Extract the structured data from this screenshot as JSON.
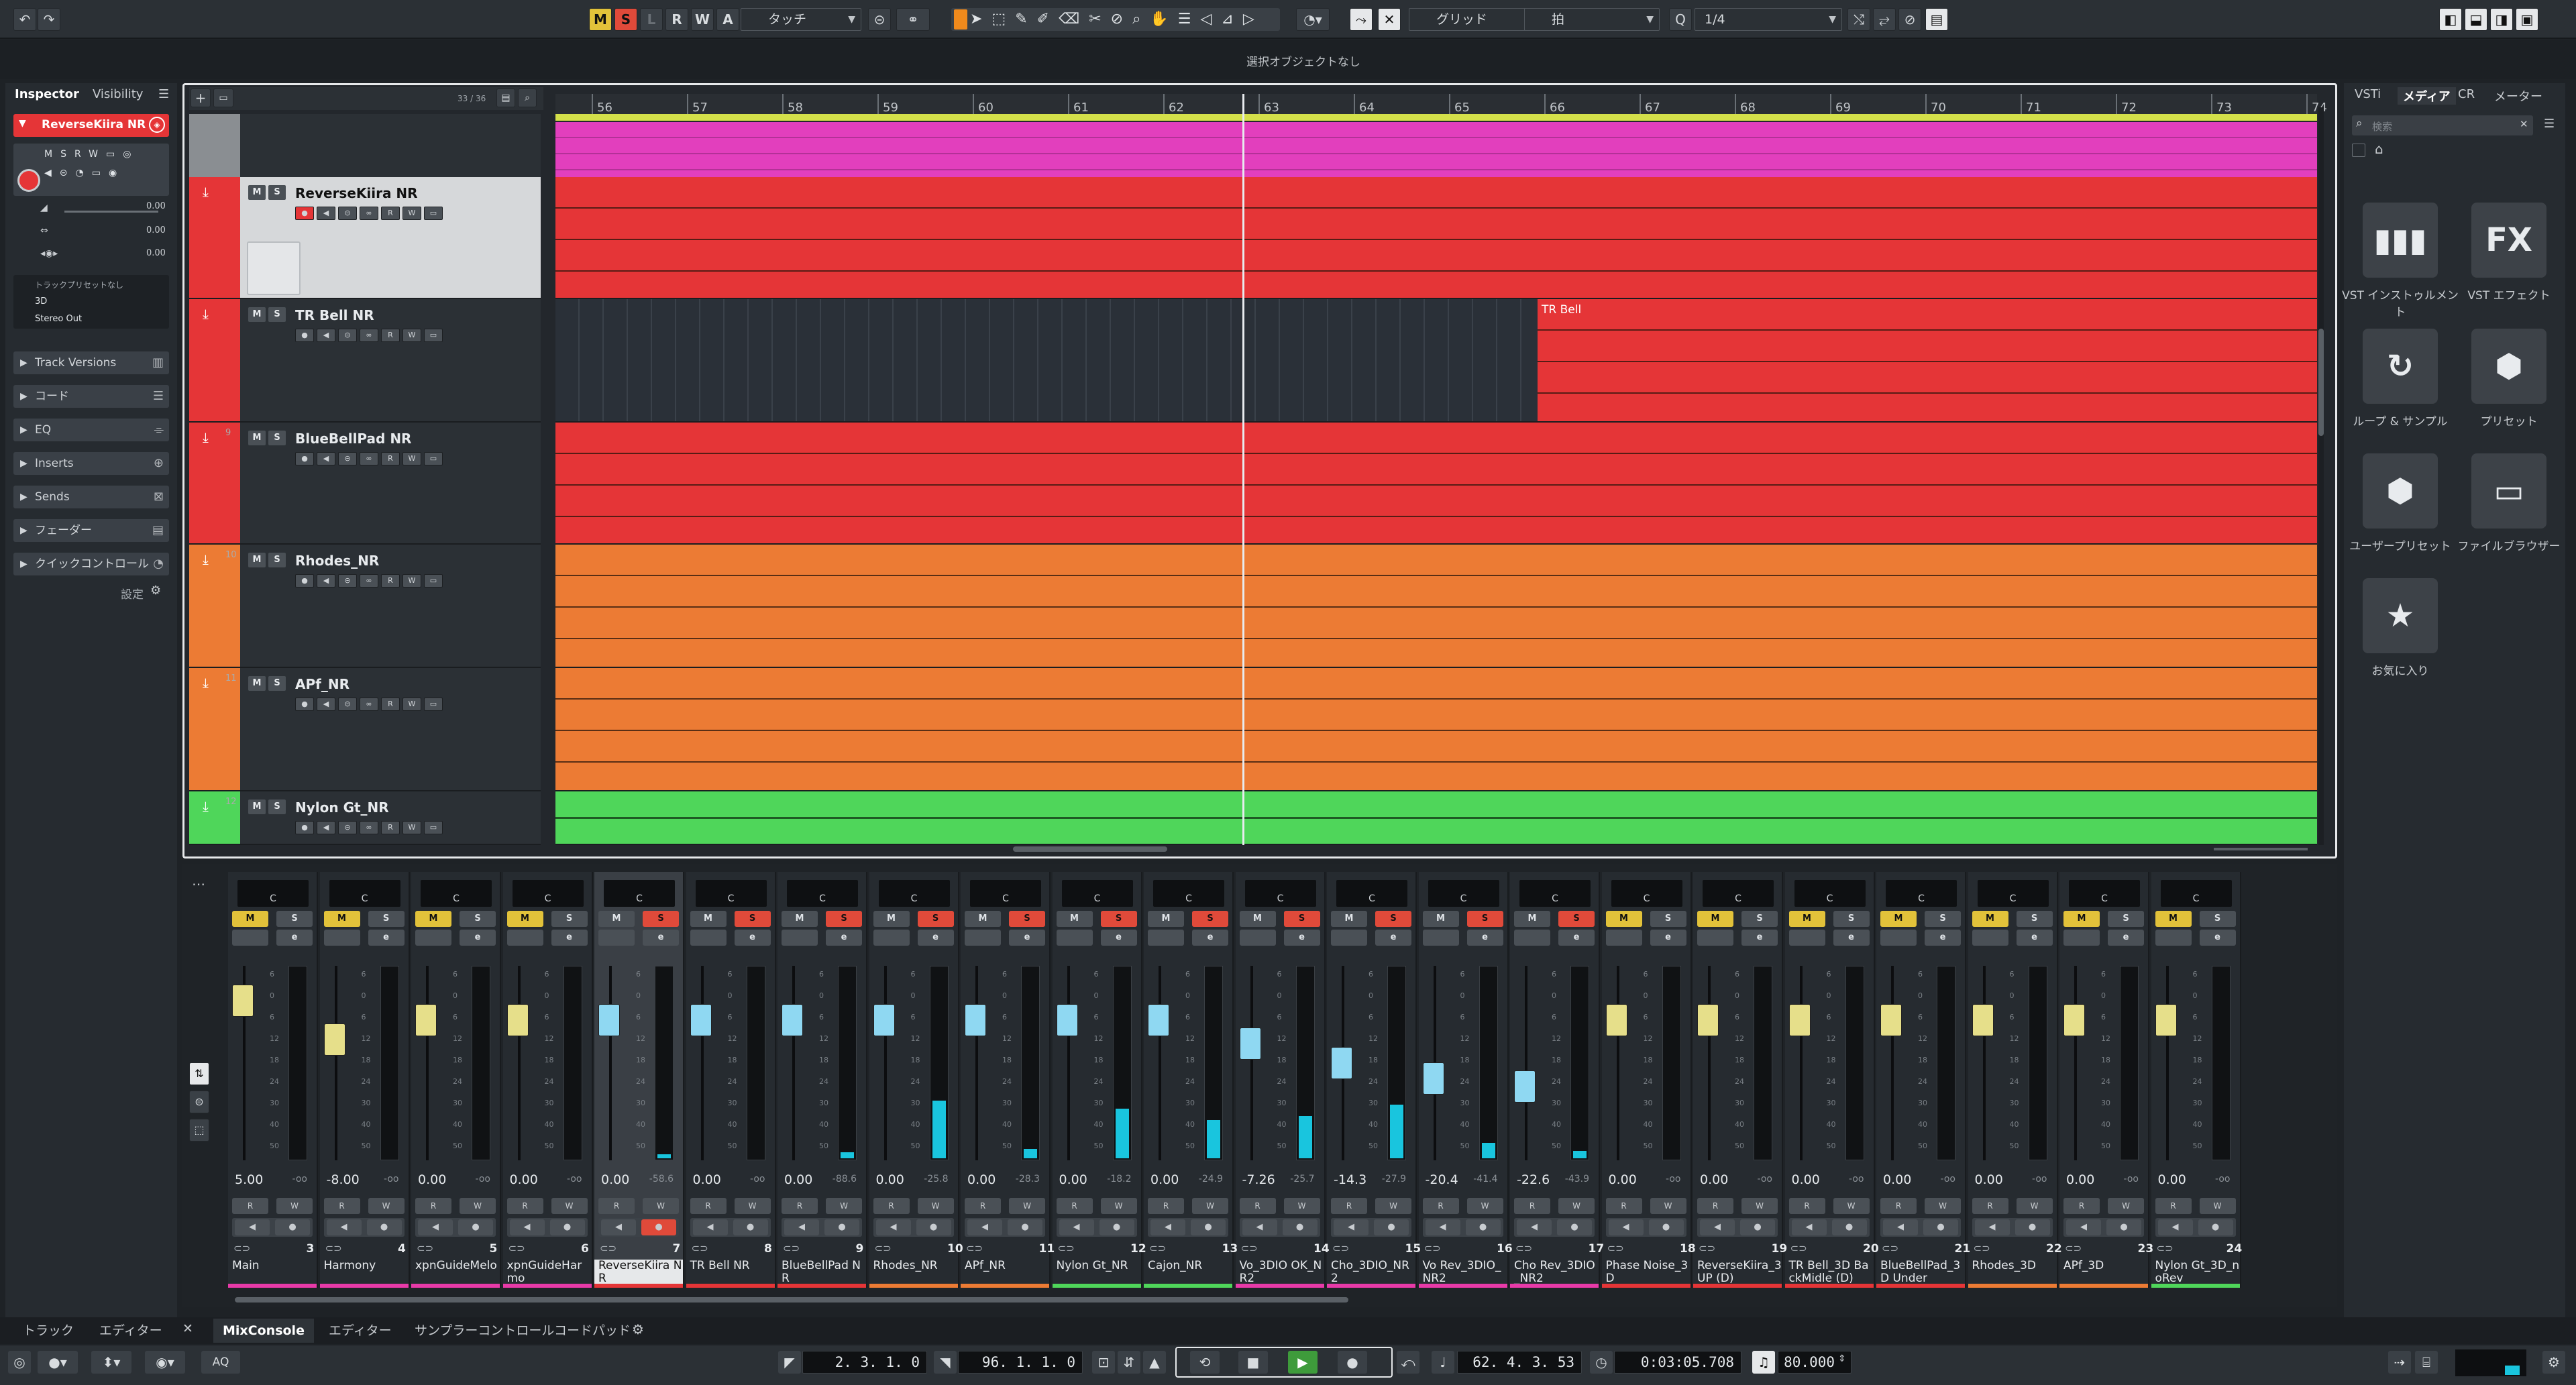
{
  "toolbar": {
    "undo_icon": "undo-icon",
    "redo_icon": "redo-icon",
    "mode_buttons": [
      "M",
      "S",
      "L",
      "R",
      "W",
      "A"
    ],
    "automation_mode": "タッチ",
    "snap_type": "グリッド",
    "grid_type": "拍",
    "quantize": "1/4"
  },
  "status_line": "選択オブジェクトなし",
  "inspector": {
    "tab_inspector": "Inspector",
    "tab_visibility": "Visibility",
    "track_name": "ReverseKiira NR",
    "volume_value": "0.00",
    "pan_value": "0.00",
    "delay_value": "0.00",
    "preset_label": "トラックプリセットなし",
    "routing_in": "3D",
    "routing_out": "Stereo Out",
    "sections": [
      "Track Versions",
      "コード",
      "EQ",
      "Inserts",
      "Sends",
      "フェーダー",
      "クイックコントロール"
    ],
    "settings_label": "設定"
  },
  "project": {
    "track_count": "33 / 36",
    "ruler": [
      "56",
      "57",
      "58",
      "59",
      "60",
      "61",
      "62",
      "63",
      "64",
      "65",
      "66",
      "67",
      "68",
      "69",
      "70",
      "71",
      "72",
      "73",
      "74"
    ],
    "tracks": [
      {
        "name": "ReverseKiira NR",
        "color": "#e53537"
      },
      {
        "name": "TR Bell NR",
        "color": "#e53537"
      },
      {
        "name": "BlueBellPad NR",
        "color": "#e53537"
      },
      {
        "name": "Rhodes_NR",
        "color": "#ec7b34"
      },
      {
        "name": "APf_NR",
        "color": "#ec7b34"
      },
      {
        "name": "Nylon Gt_NR",
        "color": "#4fd65a"
      }
    ],
    "track_numbers": [
      "9",
      "10",
      "11",
      "12"
    ],
    "event_label": "TR Bell"
  },
  "media": {
    "tabs": [
      "VSTi",
      "メディア",
      "CR",
      "メーター"
    ],
    "search_placeholder": "検索",
    "tiles": [
      {
        "label": "VST インストゥルメント",
        "icon": "piano-keys-icon",
        "glyph": "▮▮▮"
      },
      {
        "label": "VST エフェクト",
        "icon": "fx-icon",
        "glyph": "FX"
      },
      {
        "label": "ループ & サンプル",
        "icon": "loop-icon",
        "glyph": "↻"
      },
      {
        "label": "プリセット",
        "icon": "preset-icon",
        "glyph": "⬢"
      },
      {
        "label": "ユーザープリセット",
        "icon": "user-preset-icon",
        "glyph": "⬢"
      },
      {
        "label": "ファイルブラウザー",
        "icon": "file-browser-icon",
        "glyph": "▭"
      },
      {
        "label": "お気に入り",
        "icon": "star-icon",
        "glyph": "★"
      }
    ]
  },
  "mixer": {
    "channels": [
      {
        "name": "Main",
        "num": "",
        "vol": "5.00",
        "peak": "-oo",
        "color": "#e83aa8",
        "mute": "on",
        "solo": "off",
        "fader": 0.82,
        "meter": 0.0
      },
      {
        "name": "Harmony",
        "num": "3",
        "vol": "-8.00",
        "peak": "-oo",
        "color": "#e83aa8",
        "mute": "on",
        "solo": "off",
        "fader": 0.62,
        "meter": 0.0
      },
      {
        "name": "xpnGuideMelo",
        "num": "4",
        "vol": "0.00",
        "peak": "-oo",
        "color": "#e83aa8",
        "mute": "on",
        "solo": "off",
        "fader": 0.72,
        "meter": 0.0
      },
      {
        "name": "xpnGuideHarmo",
        "num": "5",
        "vol": "0.00",
        "peak": "-oo",
        "color": "#e83aa8",
        "mute": "on",
        "solo": "off",
        "fader": 0.72,
        "meter": 0.0
      },
      {
        "name": "ReverseKiira NR",
        "num": "6",
        "vol": "0.00",
        "peak": "-58.6",
        "color": "#e53537",
        "mute": "off",
        "solo": "on",
        "fader": 0.72,
        "meter": 0.02
      },
      {
        "name": "TR Bell NR",
        "num": "7",
        "vol": "0.00",
        "peak": "-oo",
        "color": "#e53537",
        "mute": "off",
        "solo": "on",
        "fader": 0.72,
        "meter": 0.0
      },
      {
        "name": "BlueBellPad NR",
        "num": "8",
        "vol": "0.00",
        "peak": "-88.6",
        "color": "#e53537",
        "mute": "off",
        "solo": "on",
        "fader": 0.72,
        "meter": 0.03
      },
      {
        "name": "Rhodes_NR",
        "num": "9",
        "vol": "0.00",
        "peak": "-25.8",
        "color": "#ec7b34",
        "mute": "off",
        "solo": "on",
        "fader": 0.72,
        "meter": 0.3
      },
      {
        "name": "APf_NR",
        "num": "10",
        "vol": "0.00",
        "peak": "-28.3",
        "color": "#ec7b34",
        "mute": "off",
        "solo": "on",
        "fader": 0.72,
        "meter": 0.05
      },
      {
        "name": "Nylon Gt_NR",
        "num": "11",
        "vol": "0.00",
        "peak": "-18.2",
        "color": "#4fd65a",
        "mute": "off",
        "solo": "on",
        "fader": 0.72,
        "meter": 0.26
      },
      {
        "name": "Cajon_NR",
        "num": "12",
        "vol": "0.00",
        "peak": "-24.9",
        "color": "#4fd65a",
        "mute": "off",
        "solo": "on",
        "fader": 0.72,
        "meter": 0.2
      },
      {
        "name": "Vo_3DIO OK_NR2",
        "num": "13",
        "vol": "-7.26",
        "peak": "-25.7",
        "color": "#e83aa8",
        "mute": "off",
        "solo": "on",
        "fader": 0.6,
        "meter": 0.22
      },
      {
        "name": "Cho_3DIO_NR2",
        "num": "14",
        "vol": "-14.3",
        "peak": "-27.9",
        "color": "#e83aa8",
        "mute": "off",
        "solo": "on",
        "fader": 0.5,
        "meter": 0.28
      },
      {
        "name": "Vo Rev_3DIO_NR2",
        "num": "15",
        "vol": "-20.4",
        "peak": "-41.4",
        "color": "#e83aa8",
        "mute": "off",
        "solo": "on",
        "fader": 0.42,
        "meter": 0.08
      },
      {
        "name": "Cho Rev_3DIO_NR2",
        "num": "16",
        "vol": "-22.6",
        "peak": "-43.9",
        "color": "#e83aa8",
        "mute": "off",
        "solo": "on",
        "fader": 0.38,
        "meter": 0.04
      },
      {
        "name": "Phase Noise_3D",
        "num": "17",
        "vol": "0.00",
        "peak": "-oo",
        "color": "#e53537",
        "mute": "on",
        "solo": "off",
        "fader": 0.72,
        "meter": 0.0
      },
      {
        "name": "ReverseKiira_3UP (D)",
        "num": "18",
        "vol": "0.00",
        "peak": "-oo",
        "color": "#e53537",
        "mute": "on",
        "solo": "off",
        "fader": 0.72,
        "meter": 0.0
      },
      {
        "name": "TR Bell_3D BackMidle (D)",
        "num": "19",
        "vol": "0.00",
        "peak": "-oo",
        "color": "#e53537",
        "mute": "on",
        "solo": "off",
        "fader": 0.72,
        "meter": 0.0
      },
      {
        "name": "BlueBellPad_3D Under",
        "num": "20",
        "vol": "0.00",
        "peak": "-oo",
        "color": "#e53537",
        "mute": "on",
        "solo": "off",
        "fader": 0.72,
        "meter": 0.0
      },
      {
        "name": "Rhodes_3D",
        "num": "21",
        "vol": "0.00",
        "peak": "-oo",
        "color": "#ec7b34",
        "mute": "on",
        "solo": "off",
        "fader": 0.72,
        "meter": 0.0
      },
      {
        "name": "APf_3D",
        "num": "22",
        "vol": "0.00",
        "peak": "-oo",
        "color": "#ec7b34",
        "mute": "on",
        "solo": "off",
        "fader": 0.72,
        "meter": 0.0
      },
      {
        "name": "Nylon Gt_3D_noRev",
        "num": "23",
        "vol": "0.00",
        "peak": "-oo",
        "color": "#4fd65a",
        "mute": "on",
        "solo": "off",
        "fader": 0.72,
        "meter": 0.0
      }
    ],
    "last_num": "24",
    "scale": [
      "6",
      "0",
      "6",
      "12",
      "18",
      "24",
      "30",
      "40",
      "50"
    ]
  },
  "bottom_tabs": {
    "left": [
      "トラック",
      "エディター"
    ],
    "main": [
      "MixConsole",
      "エディター",
      "サンプラーコントロール",
      "コードパッド"
    ]
  },
  "transport": {
    "left_locator": "2. 3. 1.   0",
    "right_locator": "96. 1. 1.   0",
    "position_bars": "62. 4. 3. 53",
    "position_time": "0:03:05.708",
    "tempo": "80.000",
    "aq_label": "AQ"
  }
}
